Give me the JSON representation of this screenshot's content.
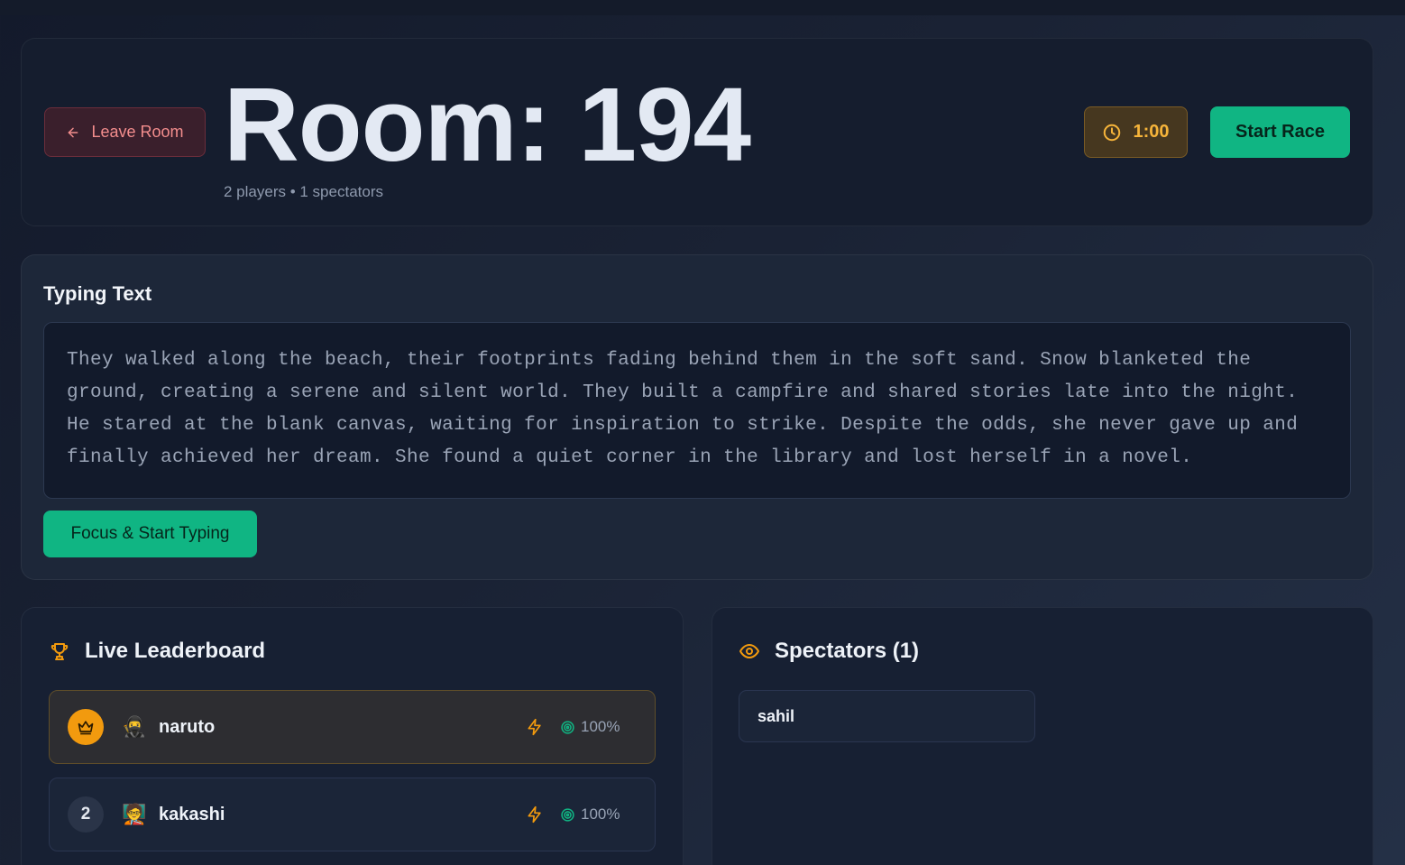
{
  "header": {
    "leave_label": "Leave Room",
    "room_title": "Room: 194",
    "room_sub": "2 players • 1 spectators",
    "timer": "1:00",
    "start_label": "Start Race"
  },
  "typing": {
    "heading": "Typing Text",
    "text": "They walked along the beach, their footprints fading behind them in the soft sand. Snow blanketed the ground, creating a serene and silent world. They built a campfire and shared stories late into the night. He stared at the blank canvas, waiting for inspiration to strike. Despite the odds, she never gave up and finally achieved her dream. She found a quiet corner in the library and lost herself in a novel.",
    "focus_label": "Focus & Start Typing"
  },
  "leaderboard": {
    "title": "Live Leaderboard",
    "players": [
      {
        "rank": "1",
        "rank_icon": "crown-icon",
        "avatar": "🥷",
        "name": "naruto",
        "accuracy": "100%"
      },
      {
        "rank": "2",
        "avatar": "🧑‍🏫",
        "name": "kakashi",
        "accuracy": "100%"
      }
    ]
  },
  "spectators": {
    "title": "Spectators (1)",
    "list": [
      "sahil"
    ]
  },
  "colors": {
    "accent_green": "#10b583",
    "accent_gold": "#f29a0e",
    "danger": "#f38d8d"
  }
}
